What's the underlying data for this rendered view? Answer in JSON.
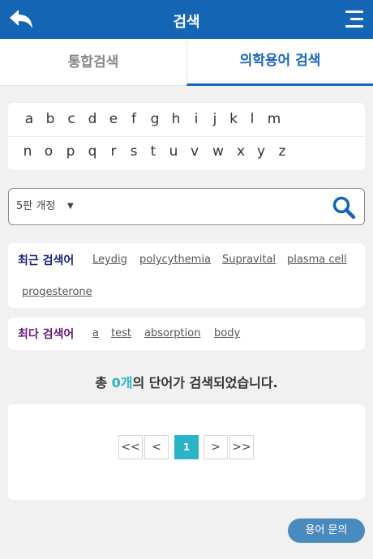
{
  "header": {
    "title": "검색",
    "back_icon": "back-arrow-icon",
    "menu_icon": "hamburger-menu-icon"
  },
  "tabs": [
    {
      "label": "통합검색"
    },
    {
      "label": "의학용어 검색"
    }
  ],
  "alphabet": {
    "row1": [
      "a",
      "b",
      "c",
      "d",
      "e",
      "f",
      "g",
      "h",
      "i",
      "j",
      "k",
      "l",
      "m"
    ],
    "row2": [
      "n",
      "o",
      "p",
      "q",
      "r",
      "s",
      "t",
      "u",
      "v",
      "w",
      "x",
      "y",
      "z"
    ]
  },
  "search": {
    "edition": "5판 개정",
    "caret": "▼",
    "value": "",
    "icon": "search-icon"
  },
  "recent": {
    "label": "최근 검색어",
    "terms": [
      "Leydig",
      "polycythemia",
      "Supravital",
      "plasma cell",
      "progesterone"
    ]
  },
  "popular": {
    "label": "최다 검색어",
    "terms": [
      "a",
      "test",
      "absorption",
      "body"
    ]
  },
  "result": {
    "prefix": "총 ",
    "count": "0개",
    "suffix": "의 단어가 검색되었습니다."
  },
  "pagination": {
    "first": "<<",
    "prev": "<",
    "current": "1",
    "next": ">",
    "last": ">>"
  },
  "ask_button": "용어 문의",
  "colors": {
    "header": "#1565b5",
    "accent": "#2bb3c7",
    "recent_label": "#1a237e",
    "popular_label": "#6a1b7a",
    "ask": "#4a8bbf"
  }
}
